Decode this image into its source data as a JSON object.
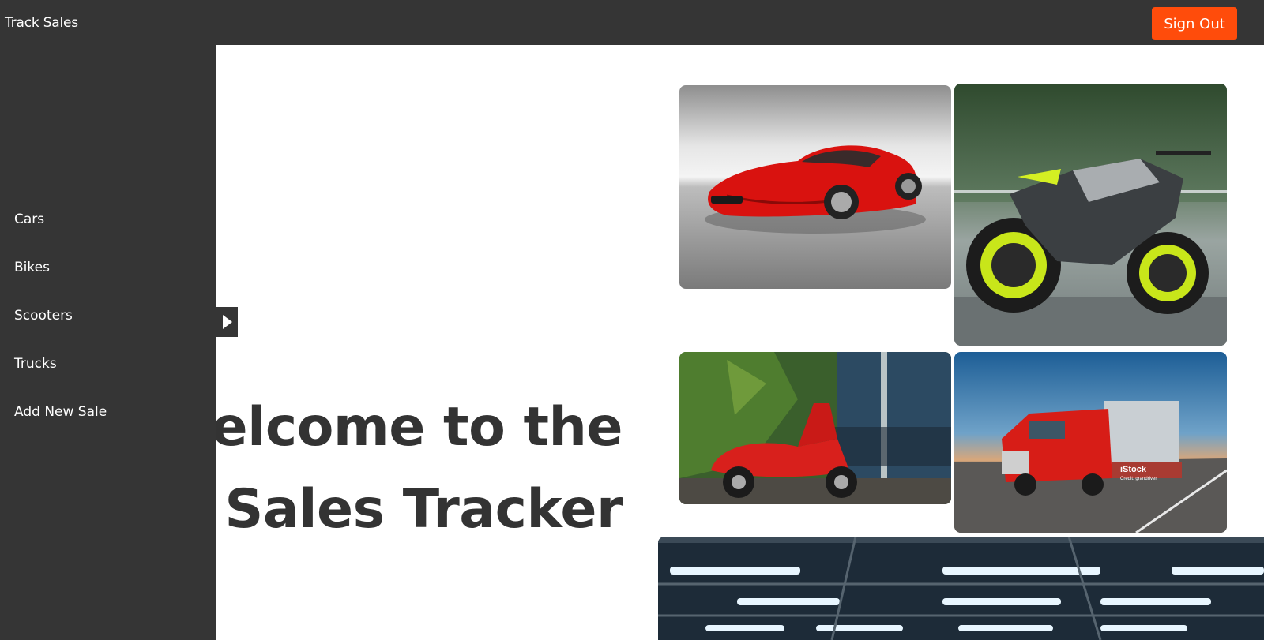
{
  "app": {
    "title": "Track Sales"
  },
  "header": {
    "signout_label": "Sign Out"
  },
  "sidebar": {
    "items": [
      {
        "label": "Cars"
      },
      {
        "label": "Bikes"
      },
      {
        "label": "Scooters"
      },
      {
        "label": "Trucks"
      },
      {
        "label": "Add New Sale"
      }
    ],
    "toggle_icon": "chevron-right-icon"
  },
  "hero": {
    "line1": "Welcome to the",
    "line2": "Vehicle Sales Tracker"
  },
  "gallery": {
    "images": [
      {
        "name": "red-sports-car-image"
      },
      {
        "name": "motorcycle-image"
      },
      {
        "name": "red-scooter-image"
      },
      {
        "name": "red-truck-image",
        "watermark": "iStock",
        "credit": "Credit: grandriver"
      },
      {
        "name": "garage-lights-image"
      }
    ]
  },
  "colors": {
    "topbar": "#353535",
    "sidebar": "#353535",
    "accent": "#ff4c0b",
    "heading": "#333333"
  }
}
